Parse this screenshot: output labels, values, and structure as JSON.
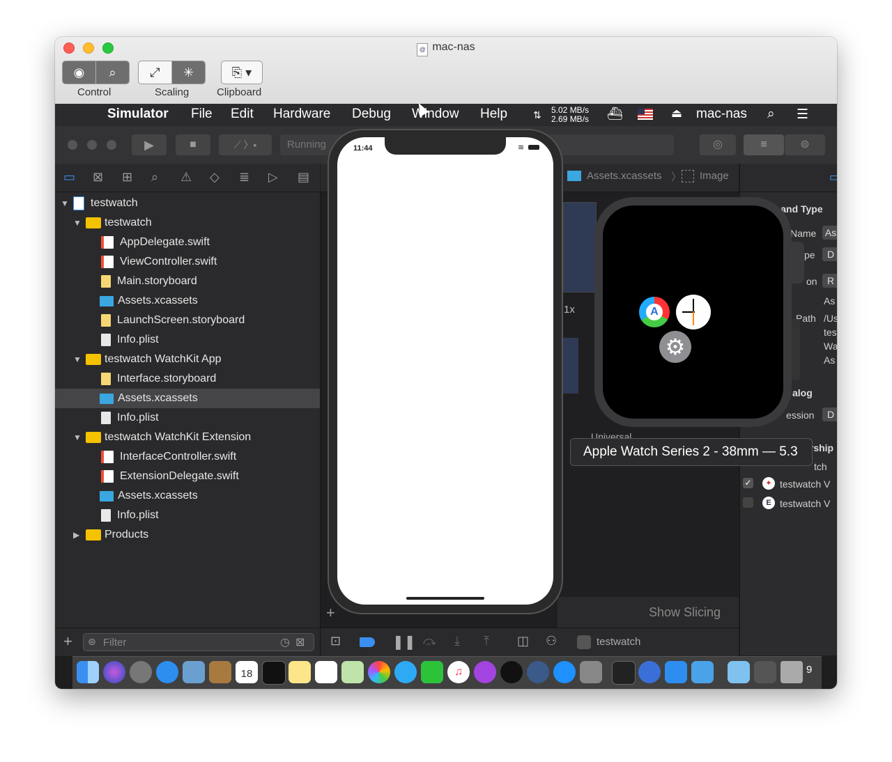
{
  "window": {
    "title": "mac-nas"
  },
  "vnc_toolbar": {
    "groups": [
      {
        "label": "Control"
      },
      {
        "label": "Scaling"
      },
      {
        "label": "Clipboard"
      }
    ]
  },
  "menubar": {
    "app": "Simulator",
    "items": [
      "File",
      "Edit",
      "Hardware",
      "Debug",
      "Window",
      "Help"
    ],
    "net_up": "5.02 MB/s",
    "net_down": "2.69 MB/s",
    "host": "mac-nas"
  },
  "xcode_toolbar": {
    "status": "Running"
  },
  "navigator": {
    "rows": [
      {
        "name": "testwatch",
        "kind": "project",
        "depth": 0,
        "expanded": true
      },
      {
        "name": "testwatch",
        "kind": "folder",
        "depth": 1,
        "expanded": true
      },
      {
        "name": "AppDelegate.swift",
        "kind": "swift",
        "depth": 2
      },
      {
        "name": "ViewController.swift",
        "kind": "swift",
        "depth": 2
      },
      {
        "name": "Main.storyboard",
        "kind": "storyboard",
        "depth": 2
      },
      {
        "name": "Assets.xcassets",
        "kind": "assets",
        "depth": 2
      },
      {
        "name": "LaunchScreen.storyboard",
        "kind": "storyboard",
        "depth": 2
      },
      {
        "name": "Info.plist",
        "kind": "plist",
        "depth": 2
      },
      {
        "name": "testwatch WatchKit App",
        "kind": "folder",
        "depth": 1,
        "expanded": true
      },
      {
        "name": "Interface.storyboard",
        "kind": "storyboard",
        "depth": 2
      },
      {
        "name": "Assets.xcassets",
        "kind": "assets",
        "depth": 2,
        "selected": true
      },
      {
        "name": "Info.plist",
        "kind": "plist",
        "depth": 2
      },
      {
        "name": "testwatch WatchKit Extension",
        "kind": "folder",
        "depth": 1,
        "expanded": true
      },
      {
        "name": "InterfaceController.swift",
        "kind": "swift",
        "depth": 2
      },
      {
        "name": "ExtensionDelegate.swift",
        "kind": "swift",
        "depth": 2
      },
      {
        "name": "Assets.xcassets",
        "kind": "assets",
        "depth": 2
      },
      {
        "name": "Info.plist",
        "kind": "plist",
        "depth": 2
      },
      {
        "name": "Products",
        "kind": "folder",
        "depth": 1,
        "expanded": false
      }
    ],
    "filter_placeholder": "Filter"
  },
  "editor": {
    "breadcrumb": [
      "Assets.xcassets",
      "Image"
    ],
    "scale": "1x",
    "universal": "Universal",
    "show_slicing": "Show Slicing"
  },
  "bottombar": {
    "scheme": "testwatch"
  },
  "inspector": {
    "section1": "ity and Type",
    "name_label": "Name",
    "name_value": "As",
    "type_label": "pe",
    "type_value": "D",
    "location_label": "on",
    "location_value": "R",
    "location_extra": "As",
    "path_label": "Path",
    "path_lines": [
      "/Us",
      "tes",
      "Wa",
      "As"
    ],
    "section2": "alog",
    "version_label": "ession",
    "version_value": "D",
    "section3": "Target Membership",
    "target_partial": "tch",
    "targets": [
      {
        "name": "testwatch V",
        "checked": true
      },
      {
        "name": "testwatch V",
        "checked": false
      }
    ]
  },
  "iphone": {
    "time": "11:44"
  },
  "watch": {
    "tooltip": "Apple Watch Series 2 - 38mm — 5.3"
  },
  "dock": {
    "calendar_day": "18",
    "partial_label": "9"
  }
}
